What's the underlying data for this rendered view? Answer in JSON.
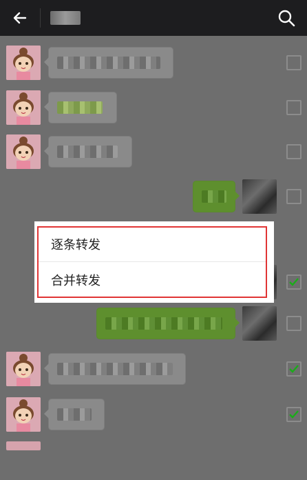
{
  "header": {
    "title": "",
    "back_icon": "arrow-left-icon",
    "search_icon": "search-icon"
  },
  "forward_menu": {
    "option_one_by_one": "逐条转发",
    "option_merge": "合并转发",
    "highlight_color": "#e03434"
  },
  "colors": {
    "topbar": "#1d1d1f",
    "checkmark": "#1aad19",
    "sent_bubble": "#9ee65f"
  },
  "messages": [
    {
      "side": "left",
      "checked": false
    },
    {
      "side": "left",
      "checked": false
    },
    {
      "side": "left",
      "checked": false
    },
    {
      "side": "right",
      "checked": false
    },
    {
      "side": "right",
      "checked": true
    },
    {
      "side": "right",
      "checked": true
    },
    {
      "side": "left",
      "checked": true
    },
    {
      "side": "left",
      "checked": true
    }
  ]
}
